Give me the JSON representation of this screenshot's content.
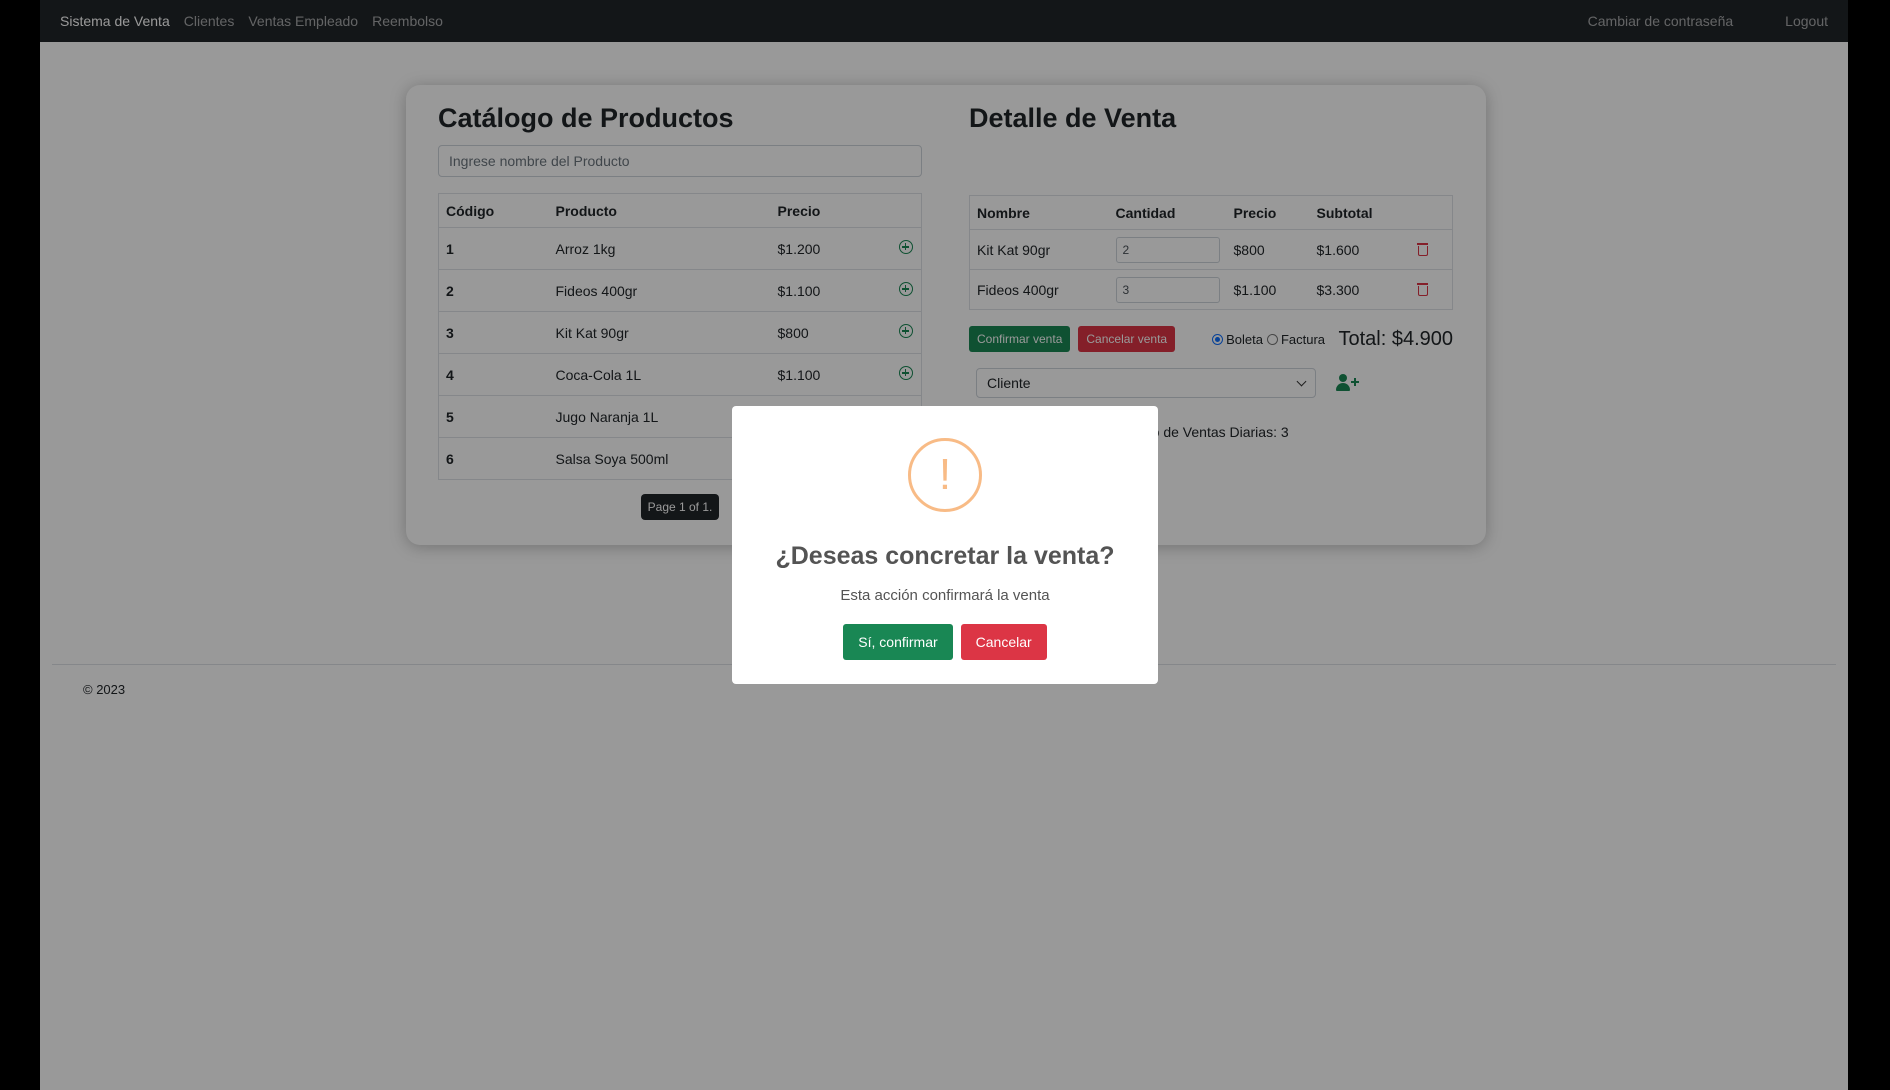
{
  "nav": {
    "brand": "Sistema de Venta",
    "links": [
      "Clientes",
      "Ventas Empleado",
      "Reembolso"
    ],
    "change_password": "Cambiar de contraseña",
    "logout": "Logout"
  },
  "catalog": {
    "title": "Catálogo de Productos",
    "search_placeholder": "Ingrese nombre del Producto",
    "headers": [
      "Código",
      "Producto",
      "Precio"
    ],
    "rows": [
      {
        "code": "1",
        "product": "Arroz 1kg",
        "price": "$1.200"
      },
      {
        "code": "2",
        "product": "Fideos 400gr",
        "price": "$1.100"
      },
      {
        "code": "3",
        "product": "Kit Kat 90gr",
        "price": "$800"
      },
      {
        "code": "4",
        "product": "Coca-Cola 1L",
        "price": "$1.100"
      },
      {
        "code": "5",
        "product": "Jugo Naranja 1L",
        "price": ""
      },
      {
        "code": "6",
        "product": "Salsa Soya 500ml",
        "price": ""
      }
    ],
    "pager": "Page 1 of 1."
  },
  "detail": {
    "title": "Detalle de Venta",
    "headers": [
      "Nombre",
      "Cantidad",
      "Precio",
      "Subtotal"
    ],
    "rows": [
      {
        "name": "Kit Kat 90gr",
        "qty": "2",
        "price": "$800",
        "subtotal": "$1.600"
      },
      {
        "name": "Fideos 400gr",
        "qty": "3",
        "price": "$1.100",
        "subtotal": "$3.300"
      }
    ],
    "confirm_btn": "Confirmar venta",
    "cancel_btn": "Cancelar venta",
    "doc_options": [
      "Boleta",
      "Factura"
    ],
    "selected_doc": "Boleta",
    "total": "Total: $4.900",
    "client_select": "Cliente",
    "daily_sales": "ro de Ventas Diarias: 3"
  },
  "footer": "© 2023",
  "modal": {
    "icon": "!",
    "title": "¿Deseas concretar la venta?",
    "text": "Esta acción confirmará la venta",
    "confirm": "Sí, confirmar",
    "cancel": "Cancelar"
  }
}
